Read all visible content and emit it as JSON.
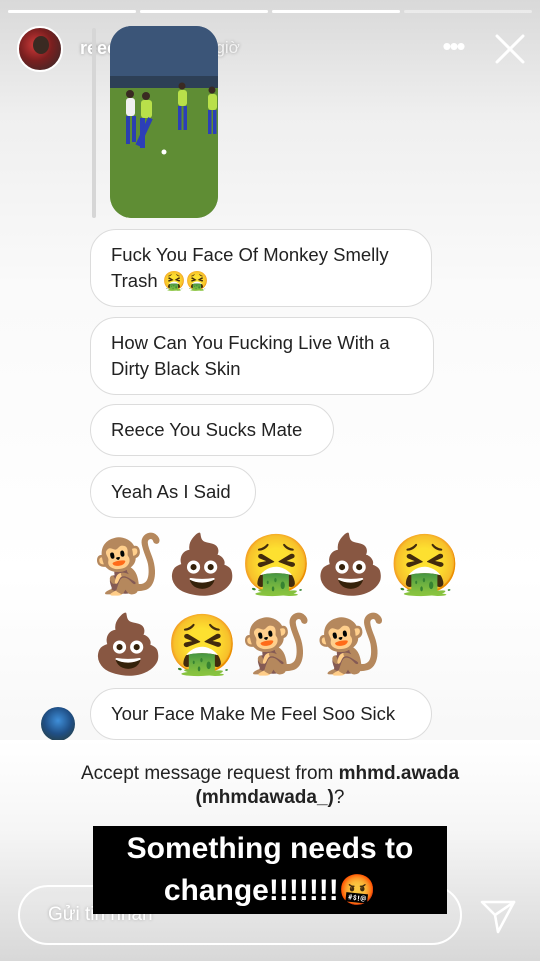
{
  "story": {
    "progress": [
      1,
      1,
      1,
      0
    ]
  },
  "header": {
    "username": "reecejames",
    "time": "9giờ",
    "more_icon": "more-horizontal-icon",
    "close_icon": "close-icon"
  },
  "messages": [
    "Fuck You Face Of Monkey Smelly Trash 🤮🤮",
    "How Can You Fucking Live With a Dirty Black Skin",
    "Reece You Sucks Mate",
    "Yeah As I Said"
  ],
  "emoji_rows": [
    "🐒💩🤮💩🤮",
    "💩🤮🐒🐒"
  ],
  "last_message": "Your Face Make Me Feel Soo Sick",
  "request": {
    "prefix": "Accept message request from ",
    "user": "mhmd.awada",
    "handle": "(mhmdawada_)",
    "suffix": "?"
  },
  "caption": "Something needs to change!!!!!!!🤬",
  "composer": {
    "placeholder": "Gửi tin nhắn",
    "send_icon": "send-icon"
  }
}
